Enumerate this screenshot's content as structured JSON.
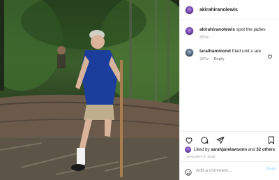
{
  "photo": {
    "alt_icon": "photo-icon"
  },
  "post": {
    "author": "akirahiranolewis",
    "comments": [
      {
        "user": "akirahiranolewis",
        "text": "spot the jadies",
        "time": "337w",
        "reply": ""
      },
      {
        "user": "taralhammond",
        "text": "fried unit u are",
        "time": "337w",
        "reply": "Reply"
      }
    ],
    "likes": {
      "prefix": "Liked by",
      "user": "sarahjanelawsonn",
      "joiner": "and",
      "others": "32 others"
    },
    "date": "JANUARY 8, 2015",
    "add_comment_placeholder": "Add a comment...",
    "post_label": "Post"
  },
  "icons": {
    "like": "heart-icon",
    "comment": "comment-icon",
    "share": "send-icon",
    "save": "bookmark-icon",
    "emoji": "emoji-icon"
  },
  "colors": {
    "post_button": "#b2dffc",
    "muted": "#8e8e8e",
    "text": "#262626"
  }
}
